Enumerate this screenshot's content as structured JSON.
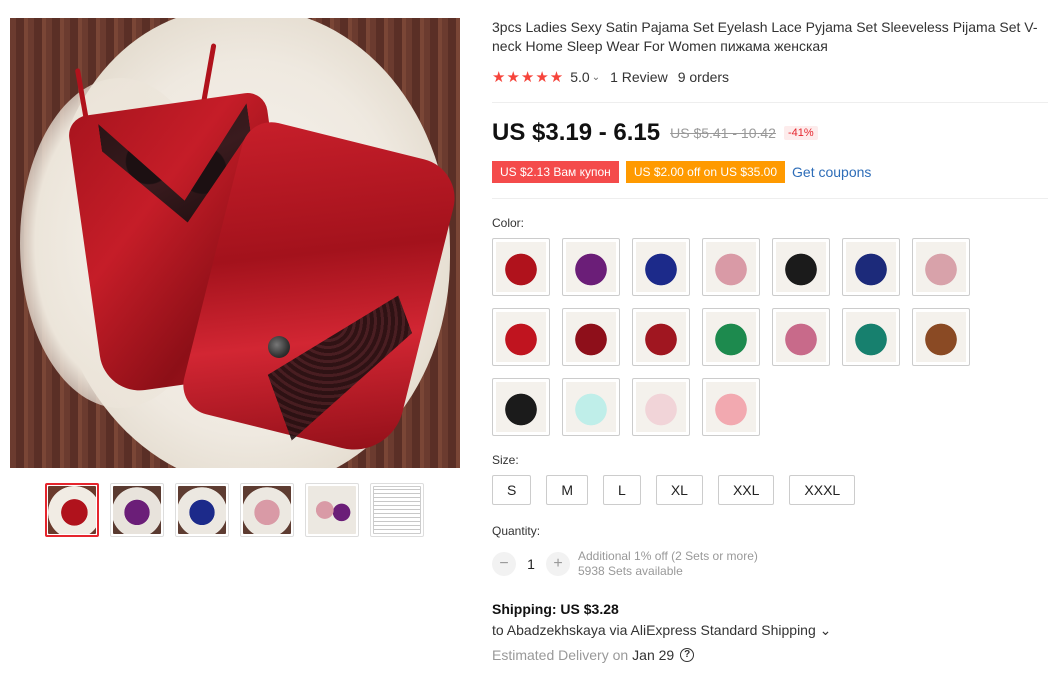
{
  "product": {
    "title": "3pcs Ladies Sexy Satin Pajama Set Eyelash Lace Pyjama Set Sleeveless Pijama Set V-neck Home Sleep Wear For Women пижама женская",
    "rating": "5.0",
    "stars": "★★★★★",
    "reviews": "1 Review",
    "orders": "9 orders"
  },
  "price": {
    "current": "US $3.19 - 6.15",
    "original": "US $5.41 - 10.42",
    "discount": "-41%"
  },
  "coupons": {
    "coupon1": "US $2.13 Вам купон",
    "coupon2": "US $2.00 off on US $35.00",
    "get_coupons": "Get coupons"
  },
  "color": {
    "label": "Color:",
    "swatch_colors": [
      "#b0121c",
      "#6b1e78",
      "#1c2a8a",
      "#d99aa6",
      "#1b1b1b",
      "#1c2a7a",
      "#d8a2aa",
      "#c0141f",
      "#8e0f1a",
      "#a01620",
      "#1d8a4e",
      "#c86a8a",
      "#17806e",
      "#8a4a24",
      "#1b1b1b",
      "#bfeee9",
      "#f1d4d8",
      "#f2a9b0"
    ]
  },
  "size": {
    "label": "Size:",
    "options": [
      "S",
      "M",
      "L",
      "XL",
      "XXL",
      "XXXL"
    ]
  },
  "quantity": {
    "label": "Quantity:",
    "minus": "−",
    "value": "1",
    "plus": "+",
    "extra_discount": "Additional 1% off (2 Sets or more)",
    "available": "5938 Sets available"
  },
  "shipping": {
    "cost": "Shipping: US $3.28",
    "route": "to Abadzekhskaya via AliExpress Standard Shipping ⌄",
    "estimated_label": "Estimated Delivery on",
    "date": "Jan 29",
    "help": "?"
  },
  "gallery": {
    "thumbs": [
      "red",
      "purple",
      "blue",
      "pink",
      "multi",
      "size-chart"
    ]
  }
}
